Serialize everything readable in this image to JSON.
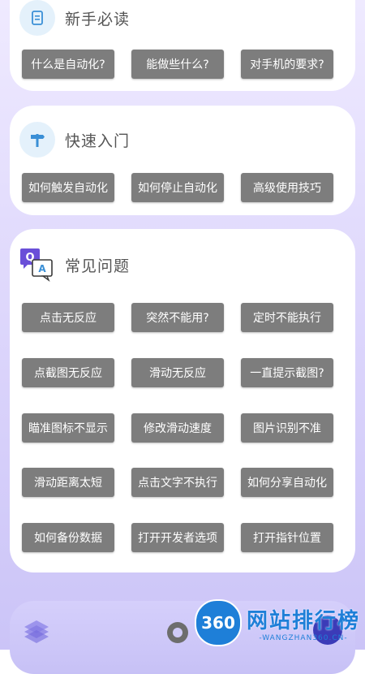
{
  "sections": [
    {
      "title": "新手必读",
      "icon": "document-icon",
      "buttons": [
        "什么是自动化?",
        "能做些什么?",
        "对手机的要求?"
      ]
    },
    {
      "title": "快速入门",
      "icon": "signpost-icon",
      "buttons": [
        "如何触发自动化",
        "如何停止自动化",
        "高级使用技巧"
      ]
    },
    {
      "title": "常见问题",
      "icon": "qa-chat-icon",
      "buttons": [
        "点击无反应",
        "突然不能用?",
        "定时不能执行",
        "点截图无反应",
        "滑动无反应",
        "一直提示截图?",
        "瞄准图标不显示",
        "修改滑动速度",
        "图片识别不准",
        "滑动距离太短",
        "点击文字不执行",
        "如何分享自动化",
        "如何备份数据",
        "打开开发者选项",
        "打开指针位置"
      ]
    }
  ],
  "watermark": {
    "badge": "360",
    "main": "网站排行榜",
    "sub": "-WANGZHAN360.CN-"
  },
  "colors": {
    "button_bg": "#7d7d7d",
    "card_bg": "#ffffff",
    "page_bg": "#d9d2fb",
    "icon_blue": "#3a8fd6",
    "icon_purple": "#6a4fd8"
  }
}
